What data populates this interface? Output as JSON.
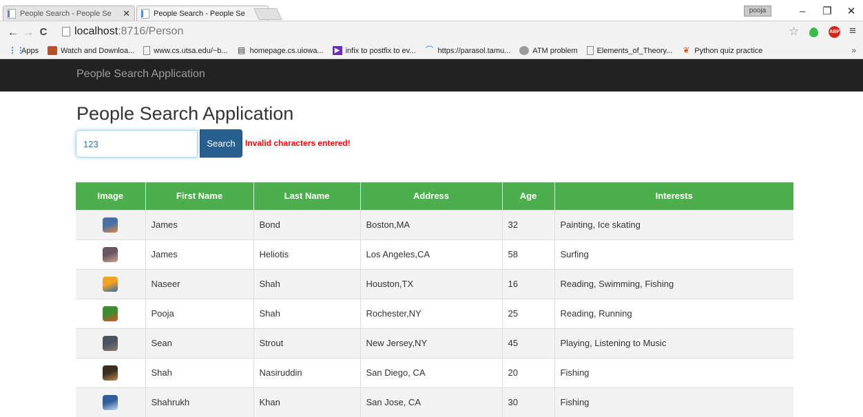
{
  "browser": {
    "tabs": [
      {
        "title": "People Search - People Se",
        "active": false
      },
      {
        "title": "People Search - People Se",
        "active": true
      }
    ],
    "tab_close_glyph": "✕",
    "profile_name": "pooja",
    "window_controls": {
      "minimize": "–",
      "restore": "❐",
      "close": "✕"
    },
    "nav": {
      "back": "←",
      "forward": "→",
      "reload": "C",
      "menu": "≡",
      "star": "☆"
    },
    "url": {
      "host": "localhost",
      "rest": ":8716/Person"
    },
    "extension_abp": "ABP",
    "bookmarks": [
      {
        "label": "Apps",
        "icon": "apps-grid-icon"
      },
      {
        "label": "Watch and Downloa...",
        "icon": "image-icon"
      },
      {
        "label": "www.cs.utsa.edu/~b...",
        "icon": "page-icon"
      },
      {
        "label": "homepage.cs.uiowa...",
        "icon": "book-icon"
      },
      {
        "label": "infix to postfix to ev...",
        "icon": "arrow-icon"
      },
      {
        "label": "https://parasol.tamu...",
        "icon": "arc-icon"
      },
      {
        "label": "ATM problem",
        "icon": "globe-icon"
      },
      {
        "label": "Elements_of_Theory...",
        "icon": "page-icon"
      },
      {
        "label": "Python quiz practice",
        "icon": "leaf-icon"
      }
    ],
    "bookmarks_overflow": "»"
  },
  "page": {
    "navbar_brand": "People Search Application",
    "title": "People Search Application",
    "search": {
      "value": "123",
      "button_label": "Search"
    },
    "error_message": "Invalid characters entered!",
    "table": {
      "header_color": "#4cae4c",
      "columns": [
        "Image",
        "First Name",
        "Last Name",
        "Address",
        "Age",
        "Interests"
      ],
      "rows": [
        {
          "first": "James",
          "last": "Bond",
          "address": "Boston,MA",
          "age": "32",
          "interests": "Painting, Ice skating",
          "thumb": [
            "#4a6fa5",
            "#d98b4a"
          ]
        },
        {
          "first": "James",
          "last": "Heliotis",
          "address": "Los Angeles,CA",
          "age": "58",
          "interests": "Surfing",
          "thumb": [
            "#6b5560",
            "#c9a48c"
          ]
        },
        {
          "first": "Naseer",
          "last": "Shah",
          "address": "Houston,TX",
          "age": "16",
          "interests": "Reading, Swimming, Fishing",
          "thumb": [
            "#f4a321",
            "#2b6cb0"
          ]
        },
        {
          "first": "Pooja",
          "last": "Shah",
          "address": "Rochester,NY",
          "age": "25",
          "interests": "Reading, Running",
          "thumb": [
            "#3c8d2f",
            "#d9532a"
          ]
        },
        {
          "first": "Sean",
          "last": "Strout",
          "address": "New Jersey,NY",
          "age": "45",
          "interests": "Playing, Listening to Music",
          "thumb": [
            "#4a5360",
            "#8d7c6a"
          ]
        },
        {
          "first": "Shah",
          "last": "Nasiruddin",
          "address": "San Diego, CA",
          "age": "20",
          "interests": "Fishing",
          "thumb": [
            "#3a2e22",
            "#b98a4e"
          ]
        },
        {
          "first": "Shahrukh",
          "last": "Khan",
          "address": "San Jose, CA",
          "age": "30",
          "interests": "Fishing",
          "thumb": [
            "#2f5e9e",
            "#c8d6e8"
          ]
        }
      ]
    }
  }
}
